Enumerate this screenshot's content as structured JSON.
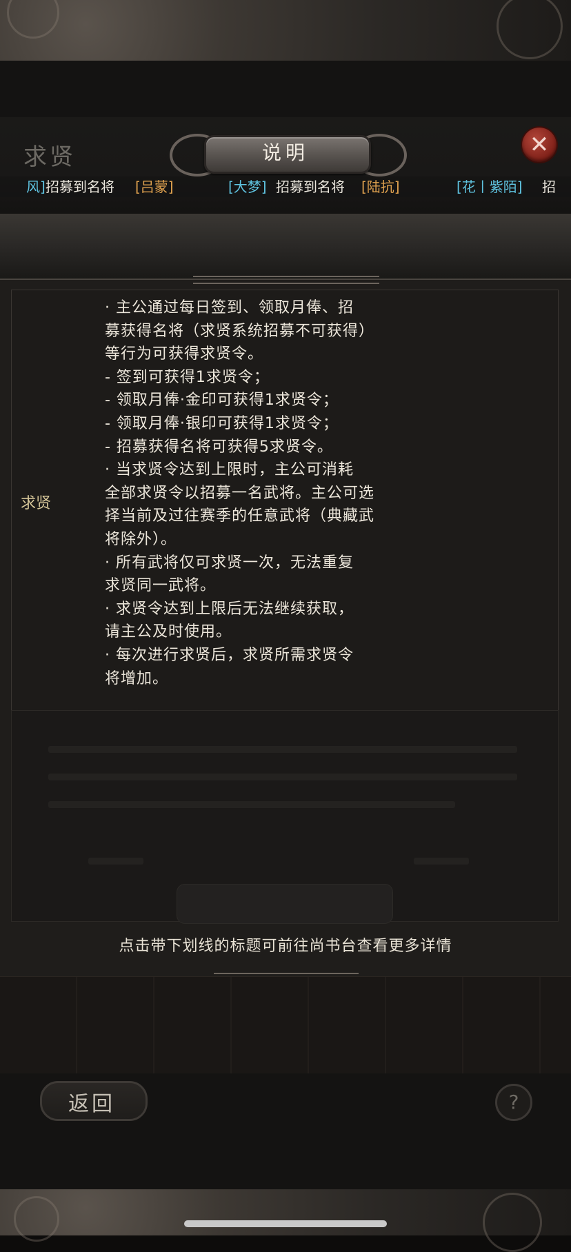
{
  "header": {
    "page_title": "求贤",
    "dialog_title": "说明",
    "close_label": "✕"
  },
  "ticker": [
    {
      "text": "风]",
      "color": "cyan"
    },
    {
      "text": "招募到名将",
      "color": "white"
    },
    {
      "text": "[吕蒙]",
      "color": "orange"
    },
    {
      "text": "[大梦]",
      "color": "cyan"
    },
    {
      "text": "招募到名将",
      "color": "white"
    },
    {
      "text": "[陆抗]",
      "color": "orange"
    },
    {
      "text": "[花丨紫陌]",
      "color": "cyan"
    },
    {
      "text": "招",
      "color": "white"
    }
  ],
  "table": {
    "row_label": "求贤",
    "lines": [
      "· 主公通过每日签到、领取月俸、招",
      "募获得名将（求贤系统招募不可获得）",
      "等行为可获得求贤令。",
      "- 签到可获得1求贤令；",
      "- 领取月俸·金印可获得1求贤令；",
      "- 领取月俸·银印可获得1求贤令；",
      "- 招募获得名将可获得5求贤令。",
      "· 当求贤令达到上限时，主公可消耗",
      "全部求贤令以招募一名武将。主公可选",
      "择当前及过往赛季的任意武将（典藏武",
      "将除外）。",
      "· 所有武将仅可求贤一次，无法重复",
      "求贤同一武将。",
      "· 求贤令达到上限后无法继续获取，",
      "请主公及时使用。",
      "· 每次进行求贤后，求贤所需求贤令",
      "将增加。"
    ]
  },
  "hint": "点击带下划线的标题可前往尚书台查看更多详情",
  "footer": {
    "back_label": "返回",
    "help_label": "?"
  },
  "colors": {
    "cyan": "#5fc3e0",
    "orange": "#e0a24f",
    "label_gold": "#d9c99b",
    "close_red": "#9a2e24"
  },
  "icons": {
    "close": "close-icon",
    "help": "help-icon"
  }
}
